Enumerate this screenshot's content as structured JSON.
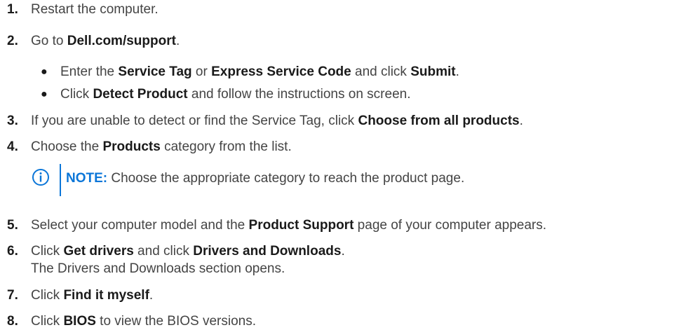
{
  "steps": [
    {
      "num": "1.",
      "t1": "Restart the computer."
    },
    {
      "num": "2.",
      "t1": "Go to ",
      "b1": "Dell.com/support",
      "t2": "."
    },
    {
      "num": "3.",
      "t1": "If you are unable to detect or find the Service Tag, click ",
      "b1": "Choose from all products",
      "t2": "."
    },
    {
      "num": "4.",
      "t1": "Choose the ",
      "b1": "Products",
      "t2": " category from the list."
    },
    {
      "num": "5.",
      "t1": "Select your computer model and the ",
      "b1": "Product Support",
      "t2": " page of your computer appears."
    },
    {
      "num": "6.",
      "t1": "Click ",
      "b1": "Get drivers",
      "t2": " and click ",
      "b2": "Drivers and Downloads",
      "t3": ".",
      "line2": "The Drivers and Downloads section opens."
    },
    {
      "num": "7.",
      "t1": "Click ",
      "b1": "Find it myself",
      "t2": "."
    },
    {
      "num": "8.",
      "t1": "Click ",
      "b1": "BIOS",
      "t2": " to view the BIOS versions."
    }
  ],
  "substeps": [
    {
      "bullet": "●",
      "t1": "Enter the ",
      "b1": "Service Tag",
      "t2": " or ",
      "b2": "Express Service Code",
      "t3": " and click ",
      "b3": "Submit",
      "t4": "."
    },
    {
      "bullet": "●",
      "t1": "Click ",
      "b1": "Detect Product",
      "t2": " and follow the instructions on screen."
    }
  ],
  "note": {
    "icon": "info-icon",
    "label": "NOTE:",
    "text": " Choose the appropriate category to reach the product page.",
    "accent_color": "#0b76d8"
  }
}
